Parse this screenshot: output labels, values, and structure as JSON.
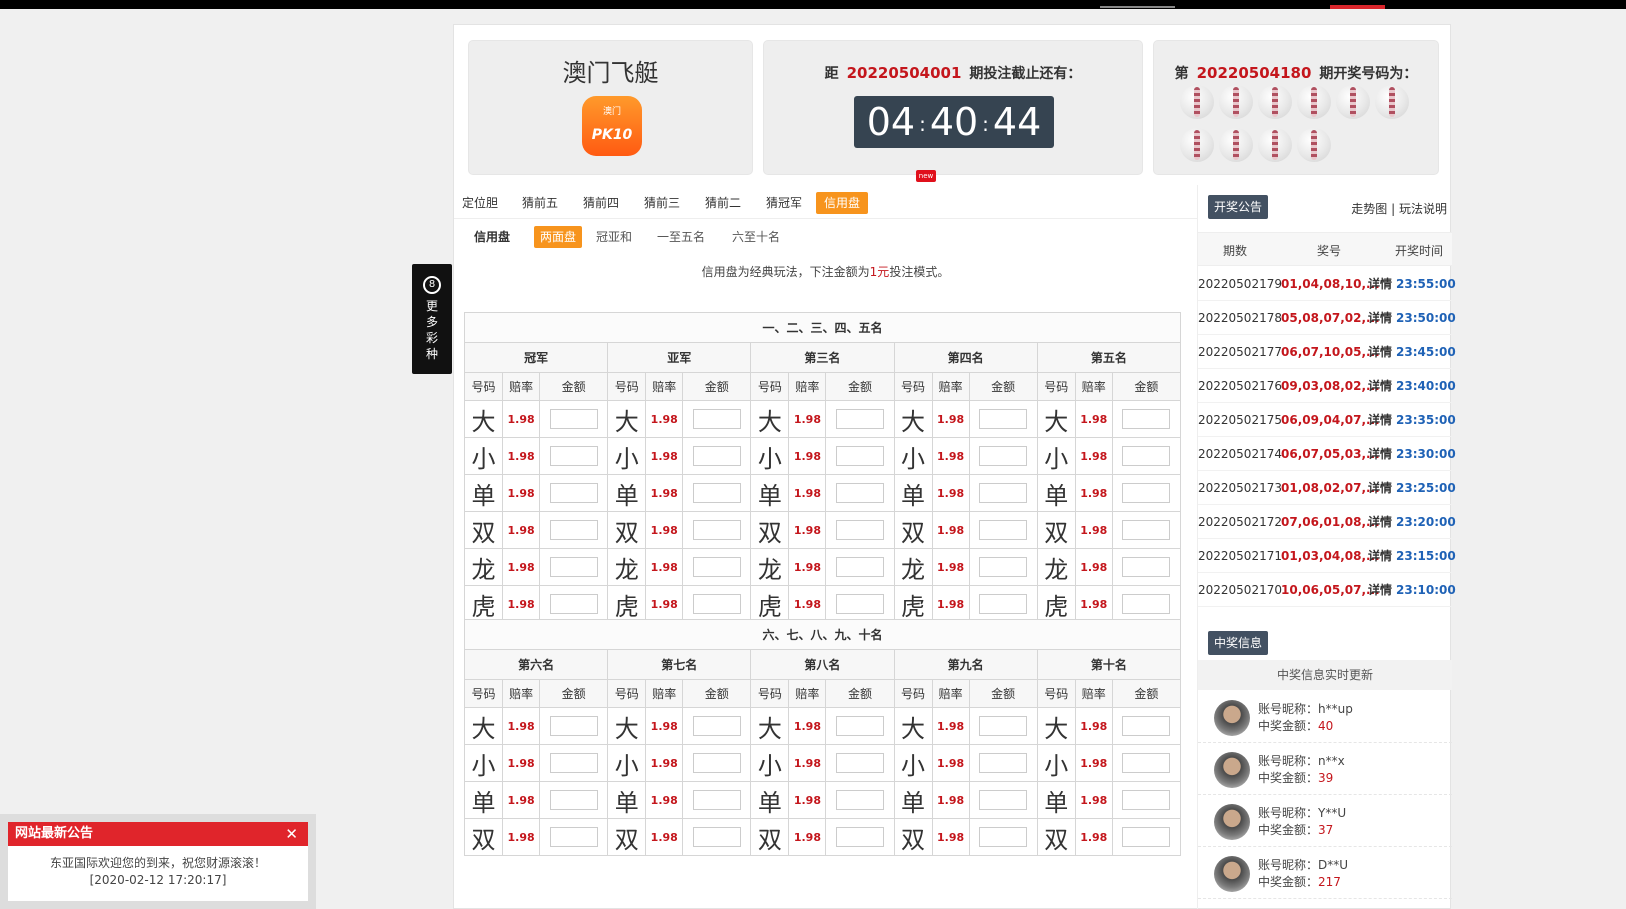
{
  "game": {
    "name": "澳门飞艇",
    "logo_top": "澳门",
    "logo_main": "PK10"
  },
  "countdown": {
    "prefix": "距",
    "period": "20220504001",
    "suffix": "期投注截止还有：",
    "h": "04",
    "m": "40",
    "s": "44",
    "new_badge": "new"
  },
  "last_draw": {
    "prefix": "第",
    "period": "20220504180",
    "suffix": "期开奖号码为："
  },
  "tabs": [
    "定位胆",
    "猜前五",
    "猜前四",
    "猜前三",
    "猜前二",
    "猜冠军",
    "信用盘"
  ],
  "active_tab": "信用盘",
  "subtabs": [
    "信用盘",
    "两面盘",
    "冠亚和",
    "一至五名",
    "六至十名"
  ],
  "active_subtab": "两面盘",
  "note": {
    "before": "信用盘为经典玩法，下注金额为",
    "amount": "1元",
    "after": "投注模式。"
  },
  "table1": {
    "title": "一、二、三、四、五名",
    "positions": [
      "冠军",
      "亚军",
      "第三名",
      "第四名",
      "第五名"
    ]
  },
  "table2": {
    "title": "六、七、八、九、十名",
    "positions": [
      "第六名",
      "第七名",
      "第八名",
      "第九名",
      "第十名"
    ]
  },
  "col_headers": {
    "num": "号码",
    "odds": "赔率",
    "amount": "金额"
  },
  "bets1": [
    "大",
    "小",
    "单",
    "双",
    "龙",
    "虎"
  ],
  "bets2": [
    "大",
    "小",
    "单",
    "双"
  ],
  "odds": "1.98",
  "right": {
    "announce_btn": "开奖公告",
    "trend_link": "走势图",
    "sep": "|",
    "rules_link": "玩法说明",
    "cols": [
      "期数",
      "奖号",
      "开奖时间"
    ],
    "results": [
      {
        "period": "20220502179",
        "nums": "01,04,08,10,...",
        "detail": "详情",
        "time": "23:55:00"
      },
      {
        "period": "20220502178",
        "nums": "05,08,07,02,...",
        "detail": "详情",
        "time": "23:50:00"
      },
      {
        "period": "20220502177",
        "nums": "06,07,10,05,...",
        "detail": "详情",
        "time": "23:45:00"
      },
      {
        "period": "20220502176",
        "nums": "09,03,08,02,...",
        "detail": "详情",
        "time": "23:40:00"
      },
      {
        "period": "20220502175",
        "nums": "06,09,04,07,...",
        "detail": "详情",
        "time": "23:35:00"
      },
      {
        "period": "20220502174",
        "nums": "06,07,05,03,...",
        "detail": "详情",
        "time": "23:30:00"
      },
      {
        "period": "20220502173",
        "nums": "01,08,02,07,...",
        "detail": "详情",
        "time": "23:25:00"
      },
      {
        "period": "20220502172",
        "nums": "07,06,01,08,...",
        "detail": "详情",
        "time": "23:20:00"
      },
      {
        "period": "20220502171",
        "nums": "01,03,04,08,...",
        "detail": "详情",
        "time": "23:15:00"
      },
      {
        "period": "20220502170",
        "nums": "10,06,05,07,...",
        "detail": "详情",
        "time": "23:10:00"
      }
    ],
    "win_btn": "中奖信息",
    "win_header": "中奖信息实时更新",
    "nick_label": "账号昵称：",
    "amount_label": "中奖金额：",
    "winners": [
      {
        "nick": "h**up",
        "amount": "40"
      },
      {
        "nick": "n**x",
        "amount": "39"
      },
      {
        "nick": "Y**U",
        "amount": "37"
      },
      {
        "nick": "D**U",
        "amount": "217"
      }
    ]
  },
  "side_tab": {
    "icon": "8",
    "text": "更多彩种"
  },
  "notice": {
    "title": "网站最新公告",
    "close": "✕",
    "text": "东亚国际欢迎您的到来，祝您财源滚滚！",
    "date": "[2020-02-12 17:20:17]"
  }
}
